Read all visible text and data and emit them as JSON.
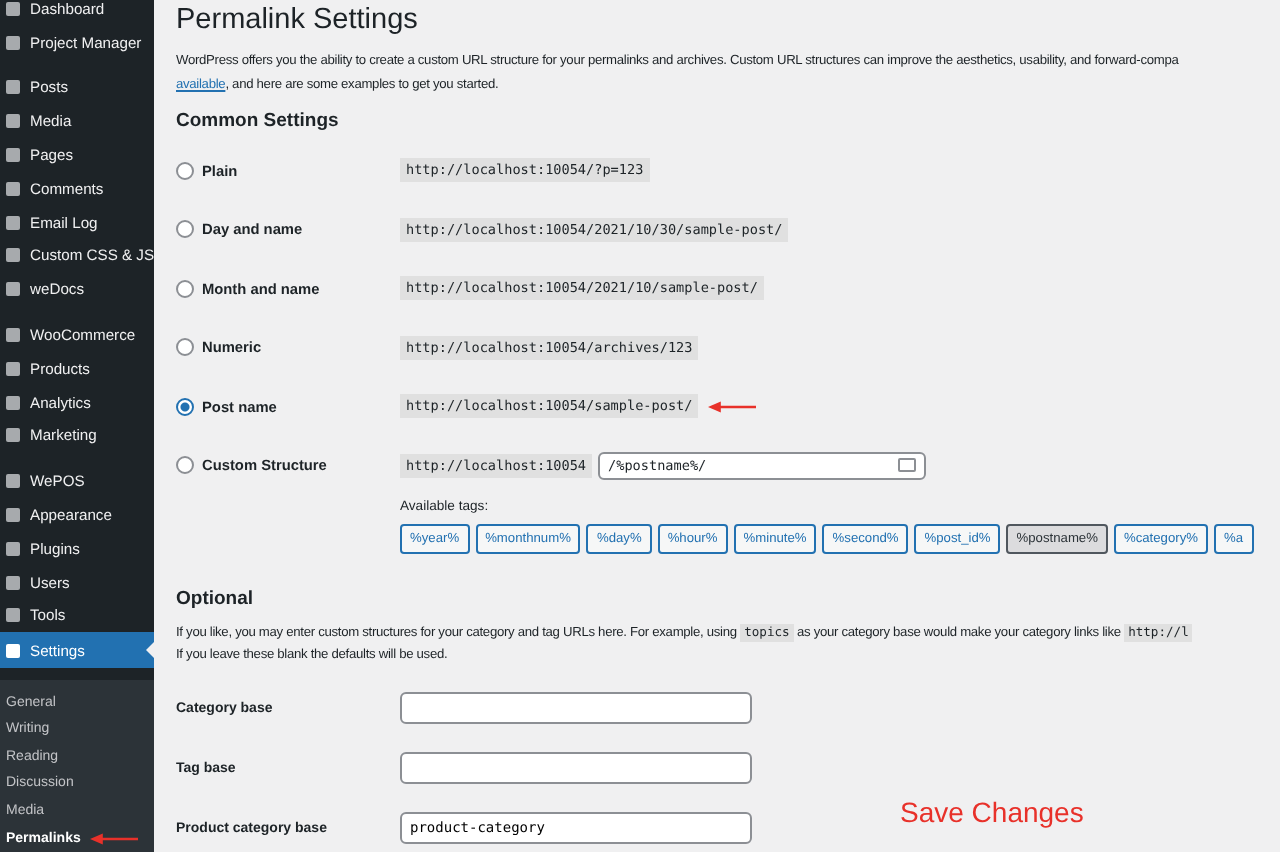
{
  "sidebar": {
    "groups": [
      [
        {
          "label": "Dashboard",
          "selected": false
        },
        {
          "label": "Project Manager",
          "selected": false
        }
      ],
      [
        {
          "label": "Posts",
          "selected": false
        },
        {
          "label": "Media",
          "selected": false
        },
        {
          "label": "Pages",
          "selected": false
        },
        {
          "label": "Comments",
          "selected": false
        },
        {
          "label": "Email Log",
          "selected": false
        },
        {
          "label": "Custom CSS & JS",
          "selected": false
        },
        {
          "label": "weDocs",
          "selected": false
        }
      ],
      [
        {
          "label": "WooCommerce",
          "selected": false
        },
        {
          "label": "Products",
          "selected": false
        },
        {
          "label": "Analytics",
          "selected": false
        },
        {
          "label": "Marketing",
          "selected": false
        }
      ],
      [
        {
          "label": "WePOS",
          "selected": false
        },
        {
          "label": "Appearance",
          "selected": false
        },
        {
          "label": "Plugins",
          "selected": false
        },
        {
          "label": "Users",
          "selected": false
        },
        {
          "label": "Tools",
          "selected": false
        },
        {
          "label": "Settings",
          "selected": true
        }
      ]
    ],
    "submenu": [
      {
        "label": "General",
        "selected": false
      },
      {
        "label": "Writing",
        "selected": false
      },
      {
        "label": "Reading",
        "selected": false
      },
      {
        "label": "Discussion",
        "selected": false
      },
      {
        "label": "Media",
        "selected": false
      },
      {
        "label": "Permalinks",
        "selected": true
      }
    ]
  },
  "page": {
    "title": "Permalink Settings",
    "intro_line": "WordPress offers you the ability to create a custom URL structure for your permalinks and archives. Custom URL structures can improve the aesthetics, usability, and forward-compa",
    "intro_link": "available",
    "intro_rest": ", and here are some examples to get you started.",
    "common_heading": "Common Settings",
    "options": [
      {
        "label": "Plain",
        "selected": false,
        "example": "http://localhost:10054/?p=123"
      },
      {
        "label": "Day and name",
        "selected": false,
        "example": "http://localhost:10054/2021/10/30/sample-post/"
      },
      {
        "label": "Month and name",
        "selected": false,
        "example": "http://localhost:10054/2021/10/sample-post/"
      },
      {
        "label": "Numeric",
        "selected": false,
        "example": "http://localhost:10054/archives/123"
      },
      {
        "label": "Post name",
        "selected": true,
        "example": "http://localhost:10054/sample-post/"
      },
      {
        "label": "Custom Structure",
        "selected": false,
        "example": "http://localhost:10054",
        "value": "/%postname%/"
      }
    ],
    "tags_label": "Available tags:",
    "tags": [
      {
        "label": "%year%",
        "selected": false
      },
      {
        "label": "%monthnum%",
        "selected": false
      },
      {
        "label": "%day%",
        "selected": false
      },
      {
        "label": "%hour%",
        "selected": false
      },
      {
        "label": "%minute%",
        "selected": false
      },
      {
        "label": "%second%",
        "selected": false
      },
      {
        "label": "%post_id%",
        "selected": false
      },
      {
        "label": "%postname%",
        "selected": true
      },
      {
        "label": "%category%",
        "selected": false
      },
      {
        "label": "%a",
        "selected": false
      }
    ],
    "optional_heading": "Optional",
    "optional_parts": [
      "If you like, you may enter custom structures for your category and tag URLs here. For example, using",
      "topics",
      "as your category base would make your category links like",
      "http://l"
    ],
    "optional_line2": "If you leave these blank the defaults will be used.",
    "fields": [
      {
        "label": "Category base"
      },
      {
        "label": "Tag base"
      },
      {
        "label": "Product category base",
        "value": "product-category"
      }
    ],
    "save_note": "Save Changes"
  }
}
